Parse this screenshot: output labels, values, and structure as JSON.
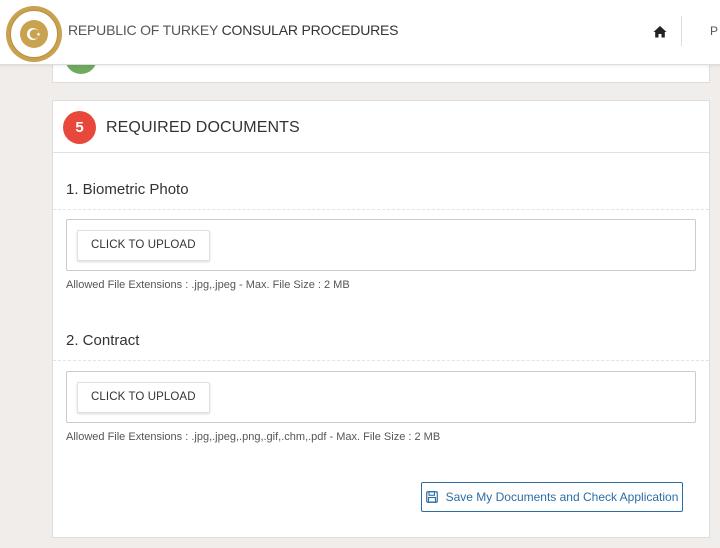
{
  "header": {
    "title_light": "REPUBLIC OF TURKEY",
    "title_bold": "CONSULAR PROCEDURES",
    "nav_partial": "P",
    "logo_icon": "state-seal-logo",
    "home_icon": "home-icon"
  },
  "section": {
    "step_number": "5",
    "title": "REQUIRED DOCUMENTS",
    "step_color": "#e8483c"
  },
  "documents": [
    {
      "title": "1. Biometric Photo",
      "upload_label": "CLICK TO UPLOAD",
      "hint": "Allowed File Extensions : .jpg,.jpeg - Max. File Size : 2 MB"
    },
    {
      "title": "2. Contract",
      "upload_label": "CLICK TO UPLOAD",
      "hint": "Allowed File Extensions : .jpg,.jpeg,.png,.gif,.chm,.pdf - Max. File Size : 2 MB"
    }
  ],
  "actions": {
    "save_label": "Save My Documents and Check Application",
    "save_icon": "floppy-disk-icon",
    "accent": "#2e6da4"
  }
}
